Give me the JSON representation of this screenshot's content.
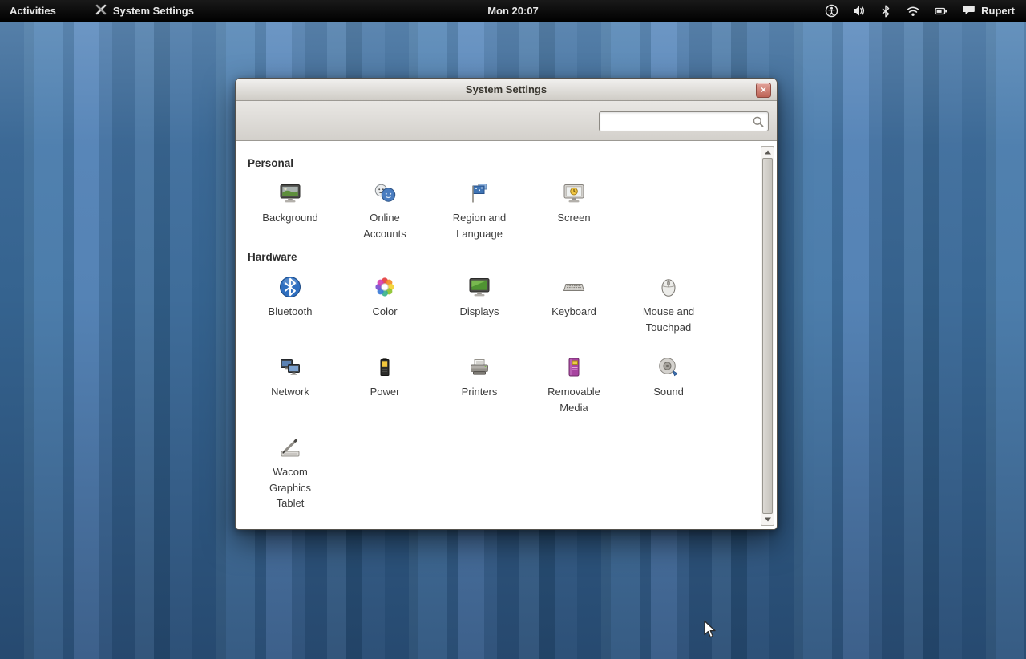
{
  "topbar": {
    "activities_label": "Activities",
    "app_title": "System Settings",
    "clock": "Mon 20:07",
    "username": "Rupert"
  },
  "window": {
    "title": "System Settings",
    "close_glyph": "×",
    "search_placeholder": "",
    "search_value": ""
  },
  "content": {
    "sections": [
      {
        "title": "Personal",
        "items": [
          {
            "label": "Background"
          },
          {
            "label": "Online Accounts"
          },
          {
            "label": "Region and Language"
          },
          {
            "label": "Screen"
          }
        ]
      },
      {
        "title": "Hardware",
        "items": [
          {
            "label": "Bluetooth"
          },
          {
            "label": "Color"
          },
          {
            "label": "Displays"
          },
          {
            "label": "Keyboard"
          },
          {
            "label": "Mouse and Touchpad"
          },
          {
            "label": "Network"
          },
          {
            "label": "Power"
          },
          {
            "label": "Printers"
          },
          {
            "label": "Removable Media"
          },
          {
            "label": "Sound"
          },
          {
            "label": "Wacom Graphics Tablet"
          }
        ]
      }
    ]
  },
  "colors": {
    "topbar_bg": "#0b0b0b",
    "wallpaper_base": "#3f6fa0",
    "window_bg": "#ffffff",
    "titlebar_text": "#39362f",
    "bluetooth_accent": "#2f6fc0"
  }
}
